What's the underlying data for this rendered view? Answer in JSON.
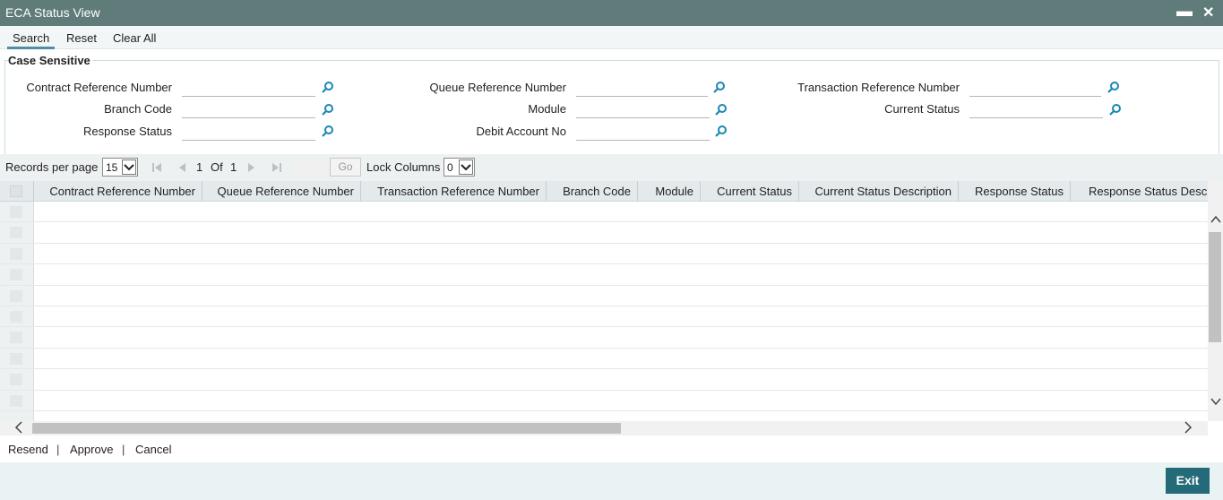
{
  "window": {
    "title": "ECA Status View",
    "minimize": "▬",
    "close": "✕"
  },
  "toolbar": {
    "search": "Search",
    "reset": "Reset",
    "clear_all": "Clear All"
  },
  "criteria": {
    "legend": "Case Sensitive",
    "fields": {
      "contract_ref": {
        "label": "Contract Reference Number",
        "value": ""
      },
      "queue_ref": {
        "label": "Queue Reference Number",
        "value": ""
      },
      "txn_ref": {
        "label": "Transaction Reference Number",
        "value": ""
      },
      "branch_code": {
        "label": "Branch Code",
        "value": ""
      },
      "module": {
        "label": "Module",
        "value": ""
      },
      "current_status": {
        "label": "Current Status",
        "value": ""
      },
      "response_status": {
        "label": "Response Status",
        "value": ""
      },
      "debit_account": {
        "label": "Debit Account No",
        "value": ""
      }
    }
  },
  "pager": {
    "records_label": "Records per page",
    "records_value": "15",
    "page_current": "1",
    "of_label": "Of",
    "page_total": "1",
    "go_label": "Go",
    "lock_label": "Lock Columns",
    "lock_value": "0"
  },
  "grid": {
    "columns": [
      "Contract Reference Number",
      "Queue Reference Number",
      "Transaction Reference Number",
      "Branch Code",
      "Module",
      "Current Status",
      "Current Status Description",
      "Response Status",
      "Response Status Description"
    ],
    "empty_rows": 10
  },
  "actions": {
    "resend": "Resend",
    "approve": "Approve",
    "cancel": "Cancel",
    "separator": "|"
  },
  "footer": {
    "exit": "Exit"
  },
  "colors": {
    "titlebar": "#5f7b7a",
    "accent": "#246a79",
    "lookup_icon": "#1a87b5"
  },
  "icons": {
    "lookup": "magnifier-icon",
    "first": "first-page-icon",
    "prev": "previous-page-icon",
    "next": "next-page-icon",
    "last": "last-page-icon"
  }
}
